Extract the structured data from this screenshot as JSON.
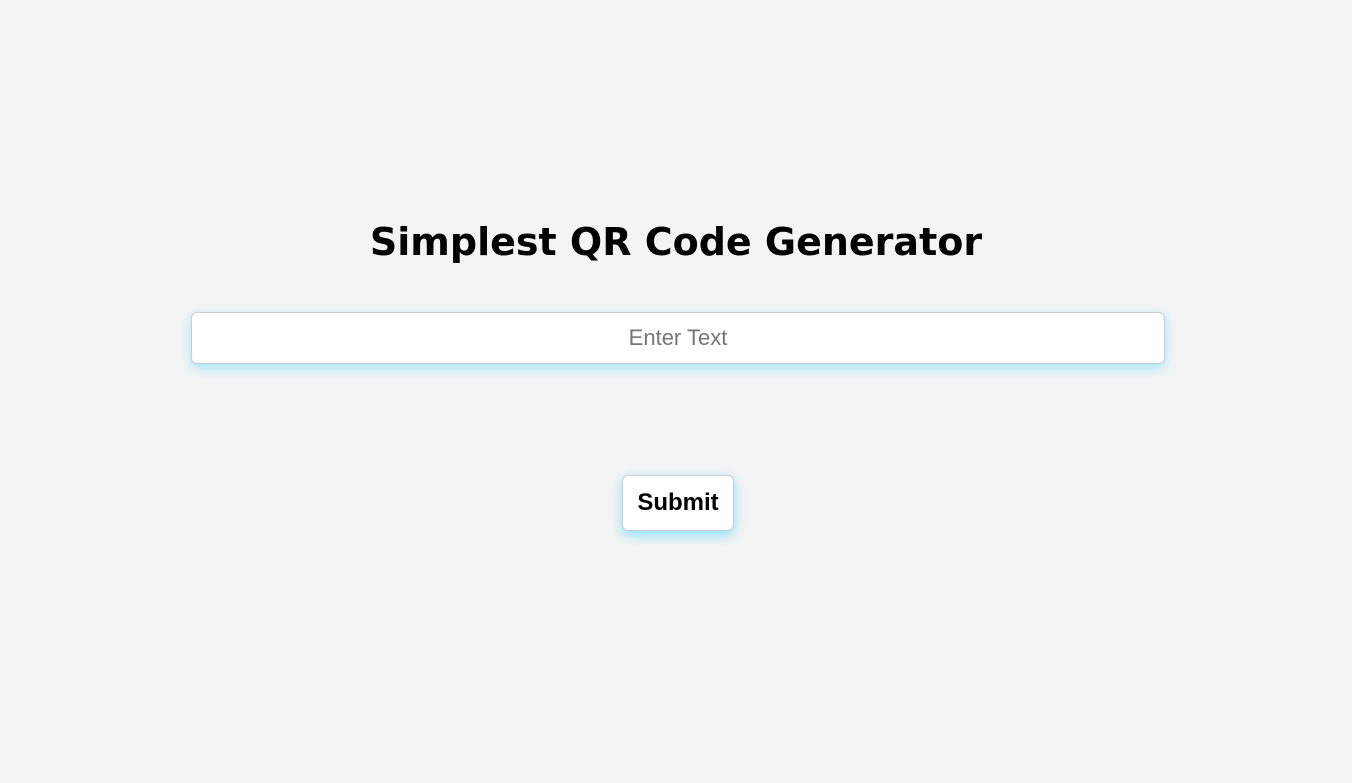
{
  "page": {
    "title": "Simplest QR Code Generator"
  },
  "form": {
    "input_value": "",
    "input_placeholder": "Enter Text",
    "submit_label": "Submit"
  },
  "colors": {
    "background": "#f4f4f4",
    "glow": "#00c8ff",
    "text": "#000000"
  }
}
